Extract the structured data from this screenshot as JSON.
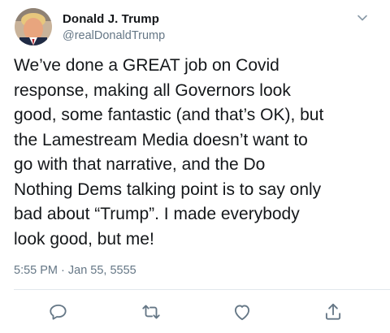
{
  "tweet": {
    "author": {
      "display_name": "Donald J. Trump",
      "handle": "@realDonaldTrump",
      "avatar_icon": "profile-photo"
    },
    "text": "We’ve done a GREAT job on Covid\nresponse, making all Governors look\ngood, some fantastic (and that’s OK), but\nthe Lamestream Media doesn’t want to\ngo with that narrative, and the Do\nNothing Dems talking point is to say only\nbad about “Trump”. I made everybody\nlook good, but me!",
    "timestamp": "5:55 PM · Jan 55, 5555",
    "menu_icon": "chevron-down-icon",
    "actions": [
      {
        "name": "reply",
        "icon": "reply-icon"
      },
      {
        "name": "retweet",
        "icon": "retweet-icon"
      },
      {
        "name": "like",
        "icon": "heart-icon"
      },
      {
        "name": "share",
        "icon": "share-icon"
      }
    ]
  },
  "colors": {
    "text_primary": "#14171a",
    "text_secondary": "#657786",
    "icon_gray": "#657786",
    "divider": "#e1e8ed"
  }
}
